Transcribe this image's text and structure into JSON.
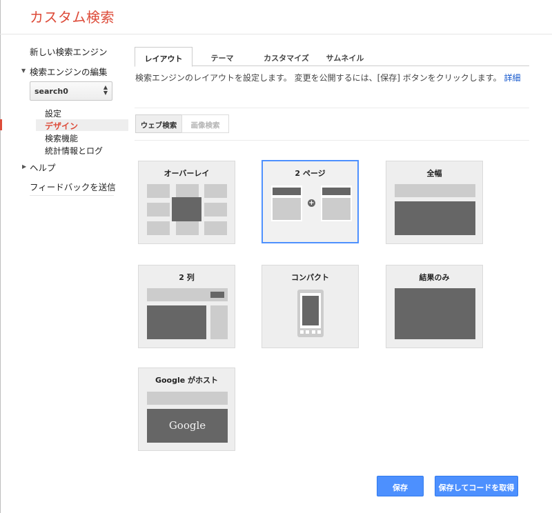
{
  "app": {
    "title": "カスタム検索"
  },
  "sidebar": {
    "new_engine": "新しい検索エンジン",
    "edit_engines": "検索エンジンの編集",
    "engine_select": {
      "value": "search0"
    },
    "sub_items": [
      {
        "label": "設定",
        "active": false
      },
      {
        "label": "デザイン",
        "active": true
      },
      {
        "label": "検索機能",
        "active": false
      },
      {
        "label": "統計情報とログ",
        "active": false
      }
    ],
    "help": "ヘルプ",
    "feedback": "フィードバックを送信"
  },
  "tabs": [
    {
      "label": "レイアウト",
      "active": true
    },
    {
      "label": "テーマ",
      "active": false
    },
    {
      "label": "カスタマイズ",
      "active": false
    },
    {
      "label": "サムネイル",
      "active": false
    }
  ],
  "description": {
    "text": "検索エンジンのレイアウトを設定します。 変更を公開するには、[保存] ボタンをクリックします。",
    "link": "詳細"
  },
  "sub_tabs": [
    {
      "label": "ウェブ検索",
      "active": true
    },
    {
      "label": "画像検索",
      "active": false
    }
  ],
  "layouts": [
    {
      "label": "オーバーレイ",
      "selected": false
    },
    {
      "label": "2 ページ",
      "selected": true
    },
    {
      "label": "全幅",
      "selected": false
    },
    {
      "label": "2 列",
      "selected": false
    },
    {
      "label": "コンパクト",
      "selected": false
    },
    {
      "label": "結果のみ",
      "selected": false
    },
    {
      "label": "Google がホスト",
      "selected": false,
      "logo_text": "Google"
    }
  ],
  "buttons": {
    "save": "保存",
    "save_get_code": "保存してコードを取得"
  },
  "colors": {
    "brand": "#dd4b39",
    "accent_blue": "#4d90fe",
    "link": "#1155cc"
  }
}
